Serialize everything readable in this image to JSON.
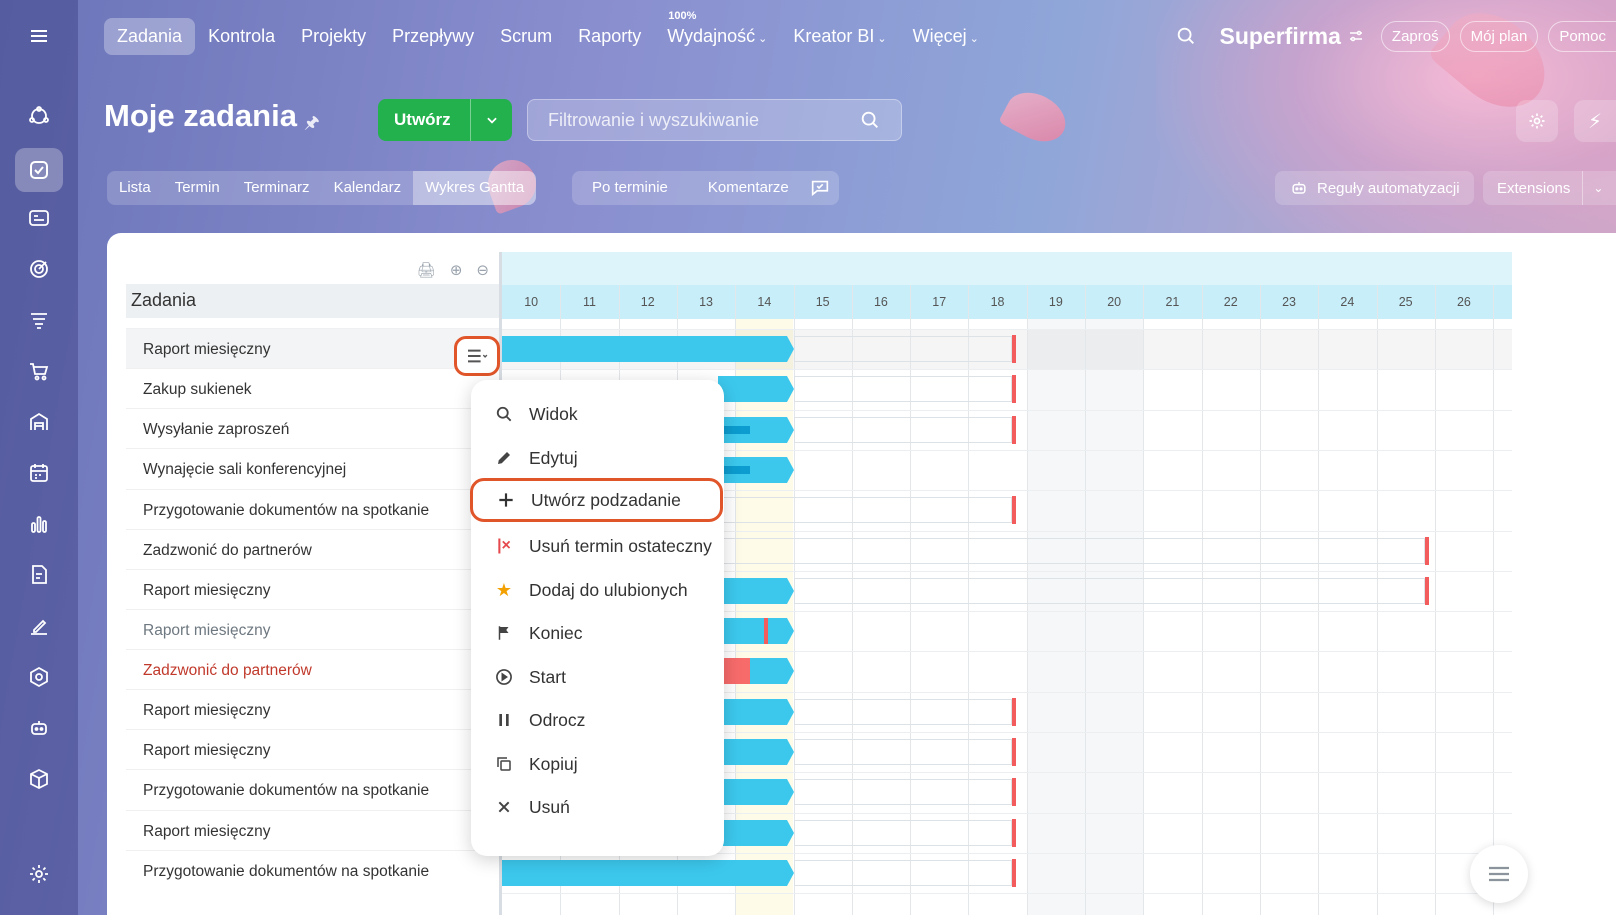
{
  "topnav": {
    "items": [
      {
        "label": "Zadania",
        "active": true
      },
      {
        "label": "Kontrola"
      },
      {
        "label": "Projekty"
      },
      {
        "label": "Przepływy"
      },
      {
        "label": "Scrum"
      },
      {
        "label": "Raporty"
      },
      {
        "label": "Wydajność",
        "badge": "100%",
        "dropdown": true
      },
      {
        "label": "Kreator BI",
        "dropdown": true
      },
      {
        "label": "Więcej",
        "dropdown": true
      }
    ],
    "brand": "Superfirma",
    "invite": "Zaproś",
    "my_plan": "Mój plan",
    "help": "Pomoc"
  },
  "header": {
    "title": "Moje zadania",
    "create_label": "Utwórz",
    "search_placeholder": "Filtrowanie i wyszukiwanie"
  },
  "views": {
    "tabs": [
      "Lista",
      "Termin",
      "Terminarz",
      "Kalendarz",
      "Wykres Gantta"
    ],
    "active": "Wykres Gantta",
    "filters": [
      "Po terminie",
      "Komentarze"
    ],
    "automation": "Reguły automatyzacji",
    "extensions": "Extensions"
  },
  "tasks": {
    "column_header": "Zadania",
    "rows": [
      {
        "title": "Raport miesięczny",
        "style": "highlight"
      },
      {
        "title": "Zakup sukienek"
      },
      {
        "title": "Wysyłanie zaproszeń"
      },
      {
        "title": "Wynajęcie sali konferencyjnej"
      },
      {
        "title": "Przygotowanie dokumentów na spotkanie"
      },
      {
        "title": "Zadzwonić do partnerów"
      },
      {
        "title": "Raport miesięczny"
      },
      {
        "title": "Raport miesięczny",
        "style": "muted"
      },
      {
        "title": "Zadzwonić do partnerów",
        "style": "overdue"
      },
      {
        "title": "Raport miesięczny"
      },
      {
        "title": "Raport miesięczny"
      },
      {
        "title": "Przygotowanie dokumentów na spotkanie"
      },
      {
        "title": "Raport miesięczny"
      },
      {
        "title": "Przygotowanie dokumentów na spotkanie"
      }
    ]
  },
  "gantt": {
    "days": [
      "10",
      "11",
      "12",
      "13",
      "14",
      "15",
      "16",
      "17",
      "18",
      "19",
      "20",
      "21",
      "22",
      "23",
      "24",
      "25",
      "26"
    ],
    "today": "14",
    "weekend": [
      "19",
      "20"
    ]
  },
  "context_menu": {
    "items": [
      {
        "label": "Widok",
        "icon": "search-icon"
      },
      {
        "label": "Edytuj",
        "icon": "pencil-icon"
      },
      {
        "label": "Utwórz podzadanie",
        "icon": "plus-icon",
        "highlighted": true
      },
      {
        "label": "Usuń termin ostateczny",
        "icon": "remove-deadline-icon"
      },
      {
        "label": "Dodaj do ulubionych",
        "icon": "star-icon"
      },
      {
        "label": "Koniec",
        "icon": "flag-icon"
      },
      {
        "label": "Start",
        "icon": "play-icon"
      },
      {
        "label": "Odrocz",
        "icon": "pause-icon"
      },
      {
        "label": "Kopiuj",
        "icon": "copy-icon"
      },
      {
        "label": "Usuń",
        "icon": "close-icon"
      }
    ]
  },
  "colors": {
    "accent_green": "#22b14c",
    "bar_blue": "#3cc8ed",
    "deadline_red": "#f25c5c",
    "highlight_orange": "#e0552a"
  }
}
